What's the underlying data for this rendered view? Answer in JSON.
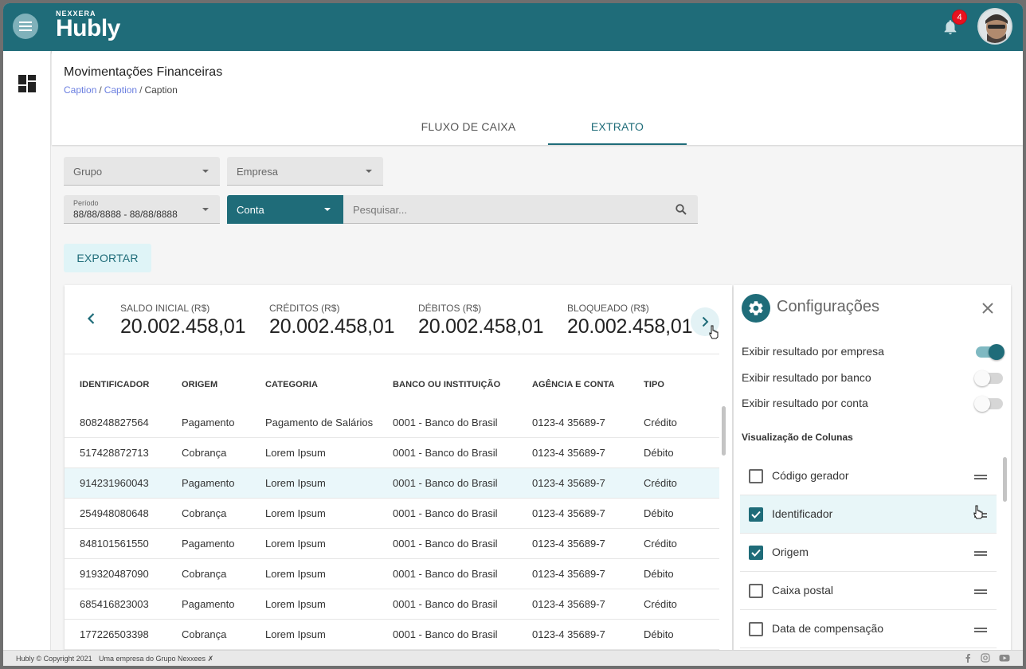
{
  "header": {
    "brand_sup": "NEXXERA",
    "brand": "Hubly",
    "notification_count": "4"
  },
  "page": {
    "title": "Movimentações Financeiras",
    "breadcrumb": [
      "Caption",
      "Caption",
      "Caption"
    ],
    "tabs": [
      "FLUXO DE CAIXA",
      "EXTRATO"
    ],
    "active_tab": "EXTRATO"
  },
  "filters": {
    "grupo": "Grupo",
    "empresa": "Empresa",
    "periodo_label": "Período",
    "periodo_value": "88/88/8888 - 88/88/8888",
    "conta": "Conta",
    "search_placeholder": "Pesquisar...",
    "export_label": "EXPORTAR"
  },
  "summary": [
    {
      "label": "SALDO INICIAL (R$)",
      "value": "20.002.458,01"
    },
    {
      "label": "CRÉDITOS (R$)",
      "value": "20.002.458,01"
    },
    {
      "label": "DÉBITOS (R$)",
      "value": "20.002.458,01"
    },
    {
      "label": "BLOQUEADO (R$)",
      "value": "20.002.458,01"
    }
  ],
  "table": {
    "columns": [
      "IDENTIFICADOR",
      "ORIGEM",
      "CATEGORIA",
      "BANCO OU INSTITUIÇÃO",
      "AGÊNCIA E CONTA",
      "TIPO"
    ],
    "rows": [
      [
        "808248827564",
        "Pagamento",
        "Pagamento de Salários",
        "0001 - Banco do Brasil",
        "0123-4 35689-7",
        "Crédito"
      ],
      [
        "517428872713",
        "Cobrança",
        "Lorem Ipsum",
        "0001 - Banco do Brasil",
        "0123-4 35689-7",
        "Débito"
      ],
      [
        "914231960043",
        "Pagamento",
        "Lorem Ipsum",
        "0001 - Banco do Brasil",
        "0123-4 35689-7",
        "Crédito"
      ],
      [
        "254948080648",
        "Cobrança",
        "Lorem Ipsum",
        "0001 - Banco do Brasil",
        "0123-4 35689-7",
        "Débito"
      ],
      [
        "848101561550",
        "Pagamento",
        "Lorem Ipsum",
        "0001 - Banco do Brasil",
        "0123-4 35689-7",
        "Crédito"
      ],
      [
        "919320487090",
        "Cobrança",
        "Lorem Ipsum",
        "0001 - Banco do Brasil",
        "0123-4 35689-7",
        "Débito"
      ],
      [
        "685416823003",
        "Pagamento",
        "Lorem Ipsum",
        "0001 - Banco do Brasil",
        "0123-4 35689-7",
        "Crédito"
      ],
      [
        "177226503398",
        "Cobrança",
        "Lorem Ipsum",
        "0001 - Banco do Brasil",
        "0123-4 35689-7",
        "Débito"
      ]
    ],
    "highlighted_row": 2
  },
  "config": {
    "title": "Configurações",
    "toggles": [
      {
        "label": "Exibir resultado por empresa",
        "on": true
      },
      {
        "label": "Exibir resultado por banco",
        "on": false
      },
      {
        "label": "Exibir resultado por conta",
        "on": false
      }
    ],
    "columns_title": "Visualização de Colunas",
    "columns": [
      {
        "label": "Código gerador",
        "checked": false
      },
      {
        "label": "Identificador",
        "checked": true
      },
      {
        "label": "Origem",
        "checked": true
      },
      {
        "label": "Caixa postal",
        "checked": false
      },
      {
        "label": "Data de compensação",
        "checked": false
      }
    ]
  },
  "footer": {
    "copyright": "Hubly © Copyright 2021",
    "company": "Uma empresa do Grupo Nexxees"
  },
  "colors": {
    "primary": "#1f6c79",
    "badge": "#e8111e",
    "highlight": "#eaf7fa"
  }
}
